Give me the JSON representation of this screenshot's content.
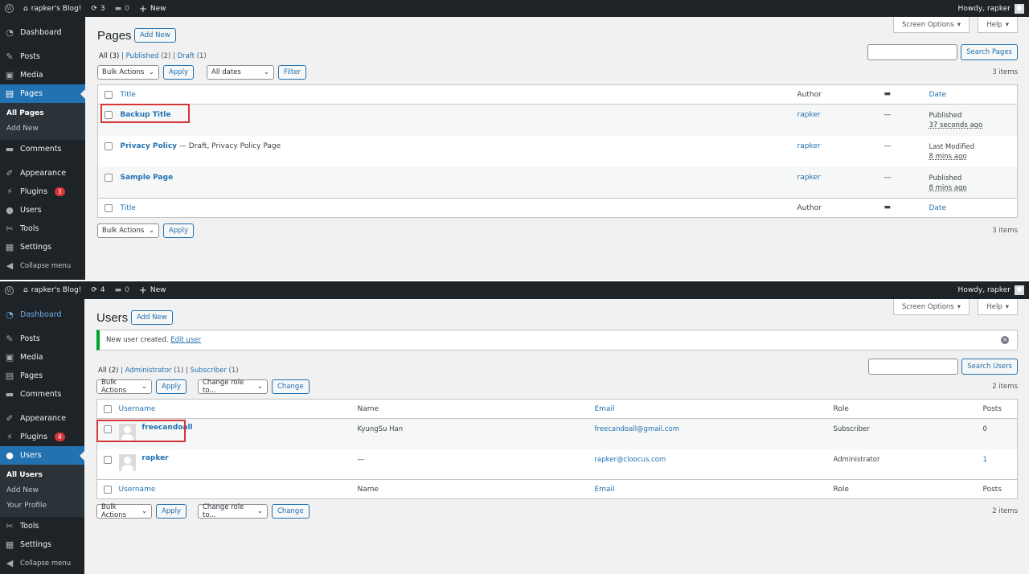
{
  "pages_screen": {
    "adminbar": {
      "site": "rapker's Blog!",
      "updates": "3",
      "comments": "0",
      "new": "New",
      "howdy": "Howdy, rapker"
    },
    "menu": [
      {
        "label": "Dashboard",
        "icon": "dashboard-icon"
      },
      {
        "label": "Posts",
        "icon": "pin-icon"
      },
      {
        "label": "Media",
        "icon": "media-icon"
      },
      {
        "label": "Pages",
        "icon": "pages-icon"
      },
      {
        "label": "Comments",
        "icon": "comment-icon"
      },
      {
        "label": "Appearance",
        "icon": "brush-icon"
      },
      {
        "label": "Plugins",
        "icon": "plugin-icon",
        "badge": "3"
      },
      {
        "label": "Users",
        "icon": "user-icon"
      },
      {
        "label": "Tools",
        "icon": "wrench-icon"
      },
      {
        "label": "Settings",
        "icon": "settings-icon"
      },
      {
        "label": "Collapse menu",
        "icon": "collapse-icon"
      }
    ],
    "submenu": [
      "All Pages",
      "Add New"
    ],
    "title": "Pages",
    "add_new": "Add New",
    "screen_options": "Screen Options",
    "help": "Help",
    "filters": {
      "all": "All",
      "all_count": "(3)",
      "published": "Published",
      "published_count": "(2)",
      "draft": "Draft",
      "draft_count": "(1)"
    },
    "search_button": "Search Pages",
    "bulk_actions": "Bulk Actions",
    "apply": "Apply",
    "all_dates": "All dates",
    "filter": "Filter",
    "items": "3 items",
    "columns": {
      "title": "Title",
      "author": "Author",
      "date": "Date"
    },
    "rows": [
      {
        "title": "Backup Title",
        "suffix": "",
        "author": "rapker",
        "comments": "—",
        "status": "Published",
        "when": "37 seconds ago"
      },
      {
        "title": "Privacy Policy",
        "suffix": " — Draft, Privacy Policy Page",
        "author": "rapker",
        "comments": "—",
        "status": "Last Modified",
        "when": "8 mins ago"
      },
      {
        "title": "Sample Page",
        "suffix": "",
        "author": "rapker",
        "comments": "—",
        "status": "Published",
        "when": "8 mins ago"
      }
    ]
  },
  "users_screen": {
    "adminbar": {
      "site": "rapker's Blog!",
      "updates": "4",
      "comments": "0",
      "new": "New",
      "howdy": "Howdy, rapker"
    },
    "menu": [
      {
        "label": "Dashboard",
        "icon": "dashboard-icon"
      },
      {
        "label": "Posts",
        "icon": "pin-icon"
      },
      {
        "label": "Media",
        "icon": "media-icon"
      },
      {
        "label": "Pages",
        "icon": "pages-icon"
      },
      {
        "label": "Comments",
        "icon": "comment-icon"
      },
      {
        "label": "Appearance",
        "icon": "brush-icon"
      },
      {
        "label": "Plugins",
        "icon": "plugin-icon",
        "badge": "4"
      },
      {
        "label": "Users",
        "icon": "user-icon"
      },
      {
        "label": "Tools",
        "icon": "wrench-icon"
      },
      {
        "label": "Settings",
        "icon": "settings-icon"
      },
      {
        "label": "Collapse menu",
        "icon": "collapse-icon"
      }
    ],
    "submenu": [
      "All Users",
      "Add New",
      "Your Profile"
    ],
    "title": "Users",
    "add_new": "Add New",
    "screen_options": "Screen Options",
    "help": "Help",
    "notice": {
      "text": "New user created.",
      "link": "Edit user"
    },
    "filters": {
      "all": "All",
      "all_count": "(2)",
      "administrator": "Administrator",
      "administrator_count": "(1)",
      "subscriber": "Subscriber",
      "subscriber_count": "(1)"
    },
    "search_button": "Search Users",
    "bulk_actions": "Bulk Actions",
    "apply": "Apply",
    "change_role": "Change role to...",
    "change": "Change",
    "items": "2 items",
    "columns": {
      "username": "Username",
      "name": "Name",
      "email": "Email",
      "role": "Role",
      "posts": "Posts"
    },
    "rows": [
      {
        "username": "freecandoall",
        "name": "KyungSu Han",
        "email": "freecandoall@gmail.com",
        "role": "Subscriber",
        "posts": "0"
      },
      {
        "username": "rapker",
        "name": "—",
        "email": "rapker@cloocus.com",
        "role": "Administrator",
        "posts": "1"
      }
    ]
  },
  "colors": {
    "accent": "#2271b1",
    "sidebar": "#1d2327",
    "highlight": "#d63638",
    "success": "#00a32a"
  }
}
